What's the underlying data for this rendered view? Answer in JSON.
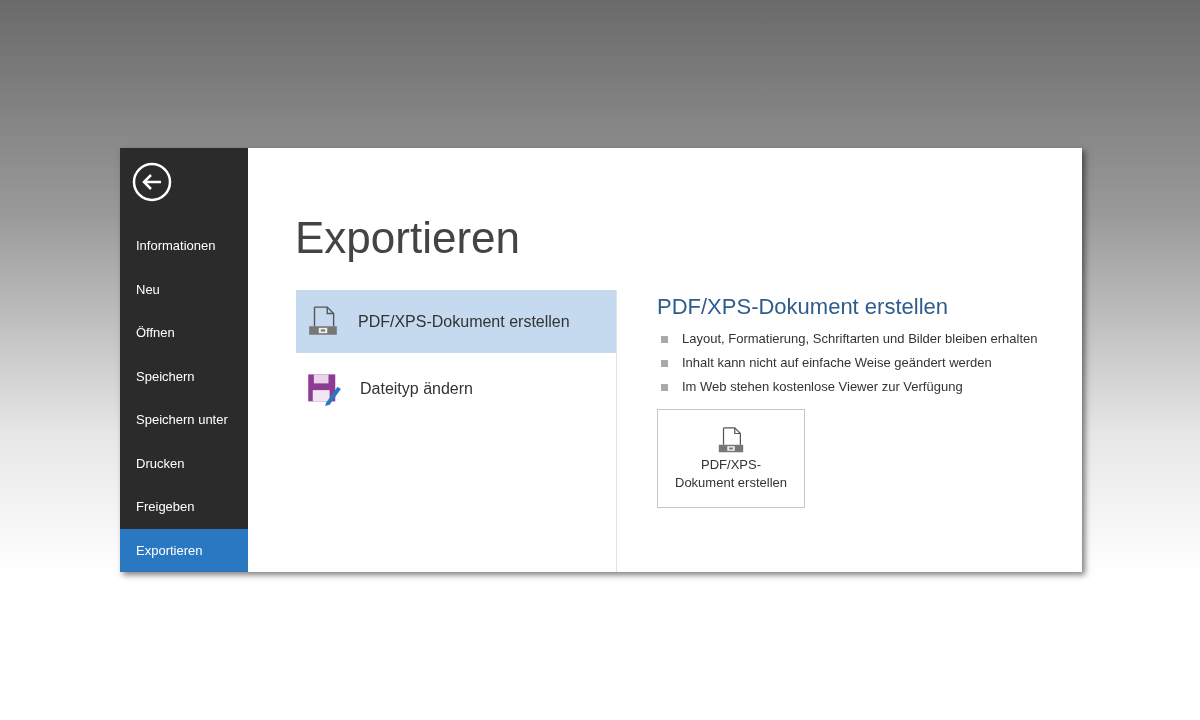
{
  "sidebar": {
    "items": [
      {
        "label": "Informationen",
        "selected": false
      },
      {
        "label": "Neu",
        "selected": false
      },
      {
        "label": "Öffnen",
        "selected": false
      },
      {
        "label": "Speichern",
        "selected": false
      },
      {
        "label": "Speichern unter",
        "selected": false
      },
      {
        "label": "Drucken",
        "selected": false
      },
      {
        "label": "Freigeben",
        "selected": false
      },
      {
        "label": "Exportieren",
        "selected": true
      }
    ]
  },
  "page_title": "Exportieren",
  "options": [
    {
      "kind": "pdf",
      "label": "PDF/XPS-Dokument erstellen",
      "selected": true
    },
    {
      "kind": "filetype",
      "label": "Dateityp ändern",
      "selected": false
    }
  ],
  "detail": {
    "heading": "PDF/XPS-Dokument erstellen",
    "bullets": [
      "Layout, Formatierung, Schriftarten und Bilder bleiben erhalten",
      "Inhalt kann nicht auf einfache Weise geändert werden",
      "Im Web stehen kostenlose Viewer zur Verfügung"
    ],
    "button": {
      "label_lines": [
        "PDF/XPS-",
        "Dokument erstellen"
      ]
    }
  }
}
